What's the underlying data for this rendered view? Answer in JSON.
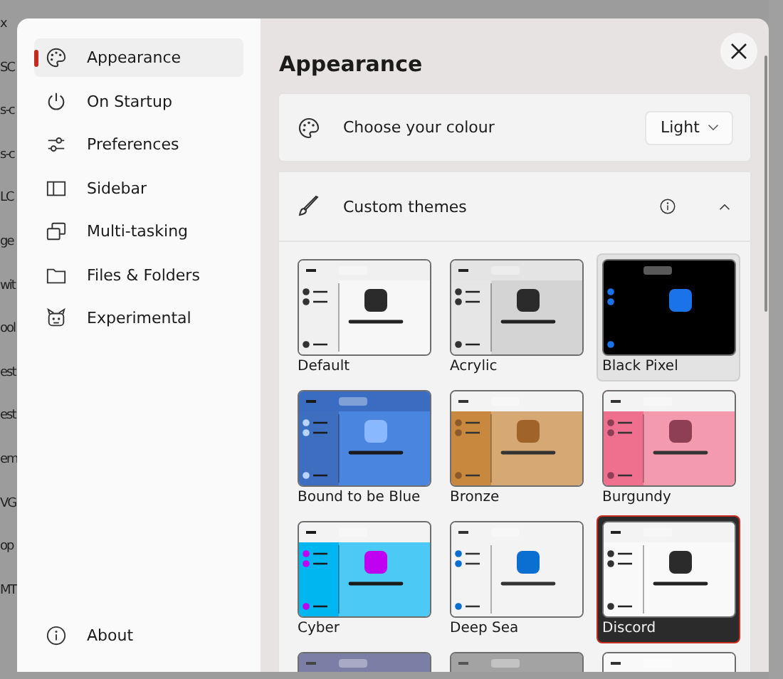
{
  "background_fragments": [
    "x",
    "SC",
    "s-c",
    "s-c",
    "LC",
    "ge",
    "wit",
    "ool",
    "est",
    "est",
    "em",
    "VG",
    "op",
    "MT"
  ],
  "sidebar": {
    "items": [
      {
        "label": "Appearance",
        "kind": "palette",
        "selected": true
      },
      {
        "label": "On Startup",
        "kind": "power",
        "selected": false
      },
      {
        "label": "Preferences",
        "kind": "sliders",
        "selected": false
      },
      {
        "label": "Sidebar",
        "kind": "panel",
        "selected": false
      },
      {
        "label": "Multi-tasking",
        "kind": "windows",
        "selected": false
      },
      {
        "label": "Files & Folders",
        "kind": "folder",
        "selected": false
      },
      {
        "label": "Experimental",
        "kind": "robot",
        "selected": false
      }
    ],
    "footer": {
      "label": "About"
    }
  },
  "page": {
    "title": "Appearance",
    "colour_setting": {
      "label": "Choose your colour",
      "value": "Light"
    },
    "custom_themes": {
      "label": "Custom themes",
      "expanded": true,
      "themes": [
        {
          "name": "Default",
          "selected": false,
          "hovered": false
        },
        {
          "name": "Acrylic",
          "selected": false,
          "hovered": false
        },
        {
          "name": "Black Pixel",
          "selected": false,
          "hovered": true
        },
        {
          "name": "Bound to be Blue",
          "selected": false,
          "hovered": false
        },
        {
          "name": "Bronze",
          "selected": false,
          "hovered": false
        },
        {
          "name": "Burgundy",
          "selected": false,
          "hovered": false
        },
        {
          "name": "Cyber",
          "selected": false,
          "hovered": false
        },
        {
          "name": "Deep Sea",
          "selected": false,
          "hovered": false
        },
        {
          "name": "Discord",
          "selected": true,
          "hovered": false
        },
        {
          "selected": false,
          "hovered": false
        },
        {
          "selected": false,
          "hovered": false
        },
        {
          "selected": false,
          "hovered": false
        }
      ]
    }
  }
}
